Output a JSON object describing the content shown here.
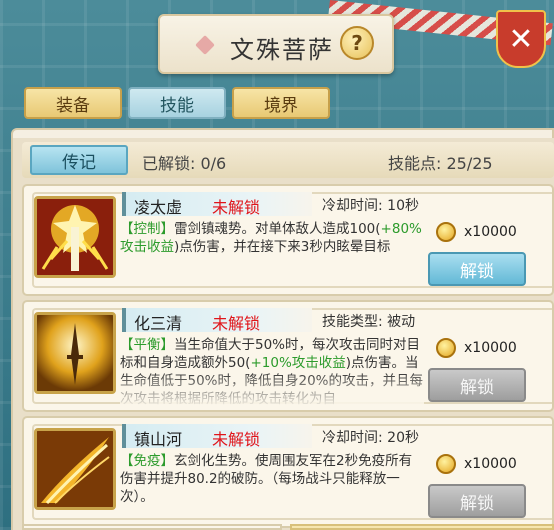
{
  "header": {
    "title": "文殊菩萨",
    "help_label": "?",
    "close_label": "✕"
  },
  "tabs": [
    {
      "label": "装备",
      "active": false
    },
    {
      "label": "技能",
      "active": true
    },
    {
      "label": "境界",
      "active": false
    }
  ],
  "summary": {
    "legend_label": "传记",
    "unlocked_text": "已解锁: 0/6",
    "points_text": "技能点:  25/25"
  },
  "skills": [
    {
      "name": "凌太虚",
      "status": "未解锁",
      "meta": "冷却时间:  10秒",
      "tag": "【控制】",
      "desc_a": "雷剑镇魂势。对单体敌人造成100(",
      "desc_g": "+80%攻击收益",
      "desc_b": ")点伤害，并在接下来3秒内眩晕目标",
      "cost": "x10000",
      "unlock_label": "解锁",
      "unlock_enabled": true,
      "icon": "lightning-sword-icon"
    },
    {
      "name": "化三清",
      "status": "未解锁",
      "meta": "技能类型:  被动",
      "tag": "【平衡】",
      "desc_a": "当生命值大于50%时，每次攻击同时对目标和自身造成额外50(",
      "desc_g": "+10%攻击收益",
      "desc_b": ")点伤害。当生命值低于50%时，降低自身20%的攻击，并且每次攻击将根据所降低的攻击转化为自",
      "cost": "x10000",
      "unlock_label": "解锁",
      "unlock_enabled": false,
      "icon": "golden-dagger-icon"
    },
    {
      "name": "镇山河",
      "status": "未解锁",
      "meta": "冷却时间:  20秒",
      "tag": "【免疫】",
      "desc_a": "玄剑化生势。使周围友军在2秒免疫所有伤害并提升80.2的破防。（每场战斗只能释放一次）。",
      "desc_g": "",
      "desc_b": "",
      "cost": "x10000",
      "unlock_label": "解锁",
      "unlock_enabled": false,
      "icon": "golden-feather-blade-icon"
    }
  ],
  "colors": {
    "locked_status": "#e0141a",
    "tag_green": "#2c9b2c",
    "accent_blue": "#63b9d6"
  }
}
